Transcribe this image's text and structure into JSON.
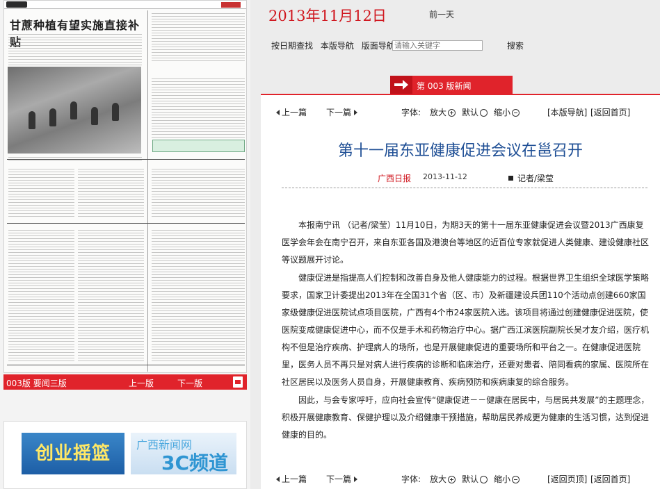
{
  "header": {
    "date": "2013年11月12日",
    "prev_day": "前一天",
    "links": [
      "按日期查找",
      "本版导航",
      "版面导航"
    ],
    "search_placeholder": "请输入关键字",
    "search_label": "搜索"
  },
  "section_tab": "第 003 版新闻",
  "newspaper": {
    "headline": "甘蔗种植有望实施直接补贴",
    "pager": {
      "page": "003版 要闻三版",
      "prev": "上一版",
      "next": "下一版"
    }
  },
  "banners": {
    "ban1": "创业摇篮",
    "ban2_line1": "广西新闻网",
    "ban2_line2": "3C频道"
  },
  "toolbar": {
    "prev": "上一篇",
    "next": "下一篇",
    "font_label": "字体:",
    "large": "放大",
    "default": "默认",
    "small": "缩小",
    "nav": "[本版导航]",
    "home": "[返回首页]",
    "back_page": "[返回页顶]",
    "home2": "[返回首页]"
  },
  "article": {
    "title": "第十一届东亚健康促进会议在邕召开",
    "source": "广西日报",
    "date": "2013-11-12",
    "author": "记者/梁莹",
    "paragraphs": [
      "本报南宁讯 （记者/梁莹）11月10日，为期3天的第十一届东亚健康促进会议暨2013广西康复医学会年会在南宁召开，来自东亚各国及港澳台等地区的近百位专家就促进人类健康、建设健康社区等议题展开讨论。",
      "健康促进是指提高人们控制和改善自身及他人健康能力的过程。根据世界卫生组织全球医学策略要求，国家卫计委提出2013年在全国31个省（区、市）及新疆建设兵团110个活动点创建660家国家级健康促进医院试点项目医院，广西有4个市24家医院入选。该项目将通过创建健康促进医院，使医院变成健康促进中心，而不仅是手术和药物治疗中心。据广西江滨医院副院长吴才友介绍，医疗机构不但是治疗疾病、护理病人的场所，也是开展健康促进的重要场所和平台之一。在健康促进医院里，医务人员不再只是对病人进行疾病的诊断和临床治疗，还要对患者、陪同看病的家属、医院所在社区居民以及医务人员自身，开展健康教育、疾病预防和疾病康复的综合服务。",
      "因此，与会专家呼吁，应向社会宣传“健康促进－－健康在居民中，与居民共发展”的主题理念，积极开展健康教育、保健护理以及介绍健康干预措施，帮助居民养成更为健康的生活习惯，达到促进健康的目的。"
    ]
  }
}
